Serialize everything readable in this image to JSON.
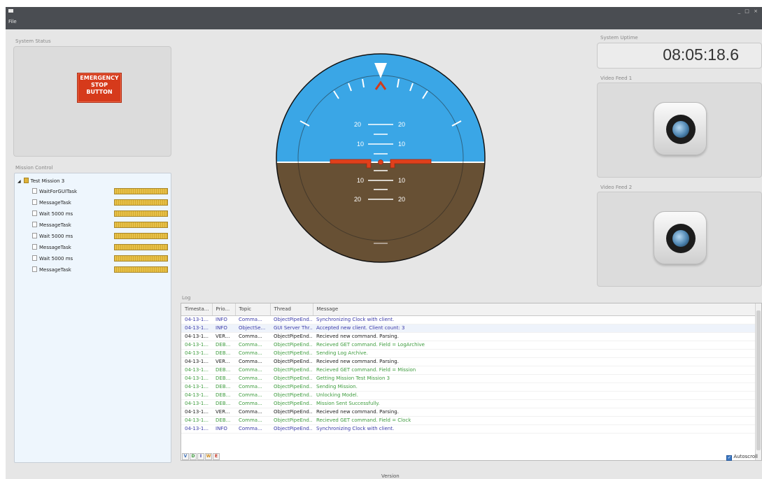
{
  "window": {
    "menu_file": "File",
    "controls": "_ □ ×"
  },
  "system_status": {
    "label": "System Status",
    "emergency_line1": "EMERGENCY",
    "emergency_line2": "STOP",
    "emergency_line3": "BUTTON",
    "emergency_color": "#d63a1b"
  },
  "mission_control": {
    "label": "Mission Control",
    "root": "Test Mission 3",
    "tasks": [
      "WaitForGUITask",
      "MessageTask",
      "Wait 5000 ms",
      "MessageTask",
      "Wait 5000 ms",
      "MessageTask",
      "Wait 5000 ms",
      "MessageTask"
    ]
  },
  "attitude": {
    "sky_color": "#3aa6e6",
    "ground_color": "#675034",
    "pitch_marks": {
      "up20": "20",
      "up10": "10",
      "down10": "10",
      "down20": "20"
    }
  },
  "uptime": {
    "label": "System Uptime",
    "value": "08:05:18.6"
  },
  "video": {
    "feed1_label": "Video Feed 1",
    "feed1_icon": "camera-icon",
    "feed2_label": "Video Feed 2",
    "feed2_icon": "camera-icon"
  },
  "log": {
    "label": "Log",
    "columns": [
      "Timesta...",
      "Prio...",
      "Topic",
      "Thread",
      "Message"
    ],
    "rows": [
      {
        "ts": "04-13-1...",
        "prio": "INFO",
        "topic": "Comma...",
        "thread": "ObjectPipeEnd...",
        "msg": "Synchronizing Clock with client."
      },
      {
        "ts": "04-13-1...",
        "prio": "INFO",
        "topic": "ObjectSe...",
        "thread": "GUI Server Thr...",
        "msg": "Accepted new client. Client count: 3"
      },
      {
        "ts": "04-13-1...",
        "prio": "VER...",
        "topic": "Comma...",
        "thread": "ObjectPipeEnd...",
        "msg": "Recieved new command. Parsing."
      },
      {
        "ts": "04-13-1...",
        "prio": "DEB...",
        "topic": "Comma...",
        "thread": "ObjectPipeEnd...",
        "msg": "Recieved GET command. Field = LogArchive"
      },
      {
        "ts": "04-13-1...",
        "prio": "DEB...",
        "topic": "Comma...",
        "thread": "ObjectPipeEnd...",
        "msg": "Sending Log Archive."
      },
      {
        "ts": "04-13-1...",
        "prio": "VER...",
        "topic": "Comma...",
        "thread": "ObjectPipeEnd...",
        "msg": "Recieved new command. Parsing."
      },
      {
        "ts": "04-13-1...",
        "prio": "DEB...",
        "topic": "Comma...",
        "thread": "ObjectPipeEnd...",
        "msg": "Recieved GET command. Field = Mission"
      },
      {
        "ts": "04-13-1...",
        "prio": "DEB...",
        "topic": "Comma...",
        "thread": "ObjectPipeEnd...",
        "msg": "Getting Mission Test Mission 3"
      },
      {
        "ts": "04-13-1...",
        "prio": "DEB...",
        "topic": "Comma...",
        "thread": "ObjectPipeEnd...",
        "msg": "Sending Mission."
      },
      {
        "ts": "04-13-1...",
        "prio": "DEB...",
        "topic": "Comma...",
        "thread": "ObjectPipeEnd...",
        "msg": "Unlocking Model."
      },
      {
        "ts": "04-13-1...",
        "prio": "DEB...",
        "topic": "Comma...",
        "thread": "ObjectPipeEnd...",
        "msg": "Mission Sent Successfully."
      },
      {
        "ts": "04-13-1...",
        "prio": "VER...",
        "topic": "Comma...",
        "thread": "ObjectPipeEnd...",
        "msg": "Recieved new command. Parsing."
      },
      {
        "ts": "04-13-1...",
        "prio": "DEB...",
        "topic": "Comma...",
        "thread": "ObjectPipeEnd...",
        "msg": "Recieved GET command. Field = Clock"
      },
      {
        "ts": "04-13-1...",
        "prio": "INFO",
        "topic": "Comma...",
        "thread": "ObjectPipeEnd...",
        "msg": "Synchronizing Clock with client."
      }
    ],
    "filters": [
      "V",
      "D",
      "I",
      "W",
      "E"
    ],
    "autoscroll_label": "Autoscroll",
    "autoscroll_checked": true
  },
  "footer": {
    "version": "Version"
  }
}
